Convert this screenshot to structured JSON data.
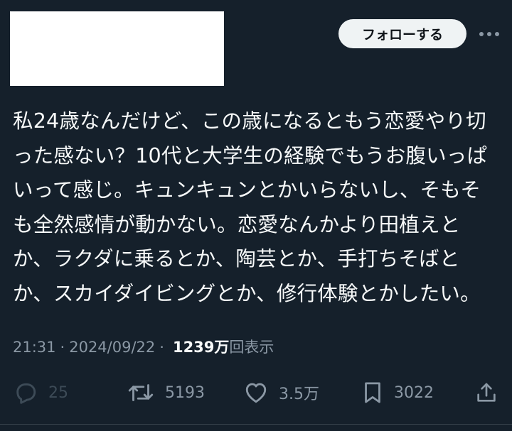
{
  "header": {
    "follow_label": "フォローする"
  },
  "tweet": {
    "lines": [
      "私24歳なんだけど、この歳になるともう恋愛やり切",
      "った感ない？10代と大学生の経験でもうお腹いっぱ",
      "いって感じ。キュンキュンとかいらないし、そもそ",
      "も全然感情が動かない。恋愛なんかより田植えと",
      "か、ラクダに乗るとか、陶芸とか、手打ちそばと",
      "か、スカイダイビングとか、修行体験とかしたい。"
    ]
  },
  "meta": {
    "time": "21:31",
    "separator": "·",
    "date": "2024/09/22",
    "views_count": "1239",
    "views_unit": "万",
    "views_label": "回表示"
  },
  "actions": {
    "reply_count": "25",
    "retweet_count": "5193",
    "like_count": "3.5万",
    "bookmark_count": "3022"
  },
  "icons": {
    "more": "more-horizontal-icon",
    "reply": "reply-icon",
    "retweet": "retweet-icon",
    "like": "heart-icon",
    "bookmark": "bookmark-icon",
    "share": "share-icon"
  },
  "colors": {
    "background": "#15202b",
    "text": "#f7f9f9",
    "secondary_text": "#8b98a5",
    "follow_button_bg": "#eff3f4",
    "follow_button_text": "#0f1419"
  }
}
